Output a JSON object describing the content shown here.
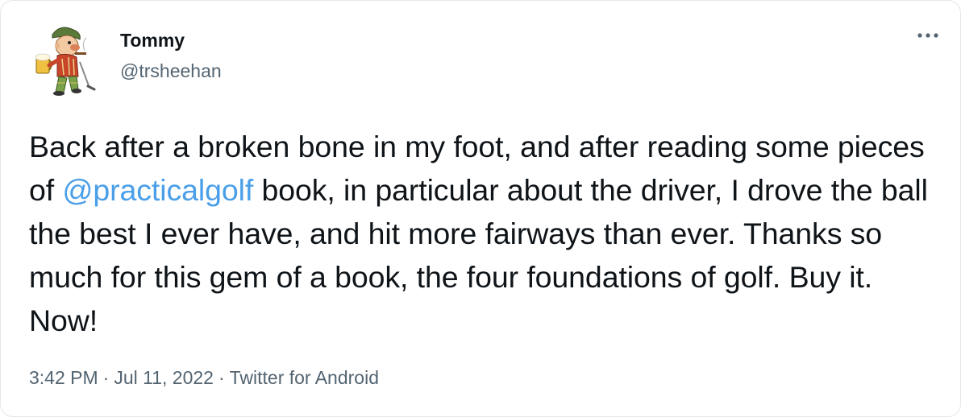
{
  "author": {
    "display_name": "Tommy",
    "handle": "@trsheehan"
  },
  "tweet": {
    "text_before_mention": "Back after a broken bone in my foot, and after reading some pieces of ",
    "mention": "@practicalgolf",
    "text_after_mention": " book, in particular about the driver, I drove the ball the best I ever have, and hit more fairways than ever. Thanks so much for this gem of a book, the four foundations of golf. Buy it. Now!"
  },
  "meta": {
    "time": "3:42 PM",
    "date": "Jul 11, 2022",
    "separator": "·",
    "source": "Twitter for Android"
  },
  "icons": {
    "more": "more-options-icon",
    "avatar": "avatar-cartoon-golfer"
  },
  "colors": {
    "text": "#0f1419",
    "secondary": "#536471",
    "link": "#4a9fe8",
    "border": "#e1e8ed"
  }
}
